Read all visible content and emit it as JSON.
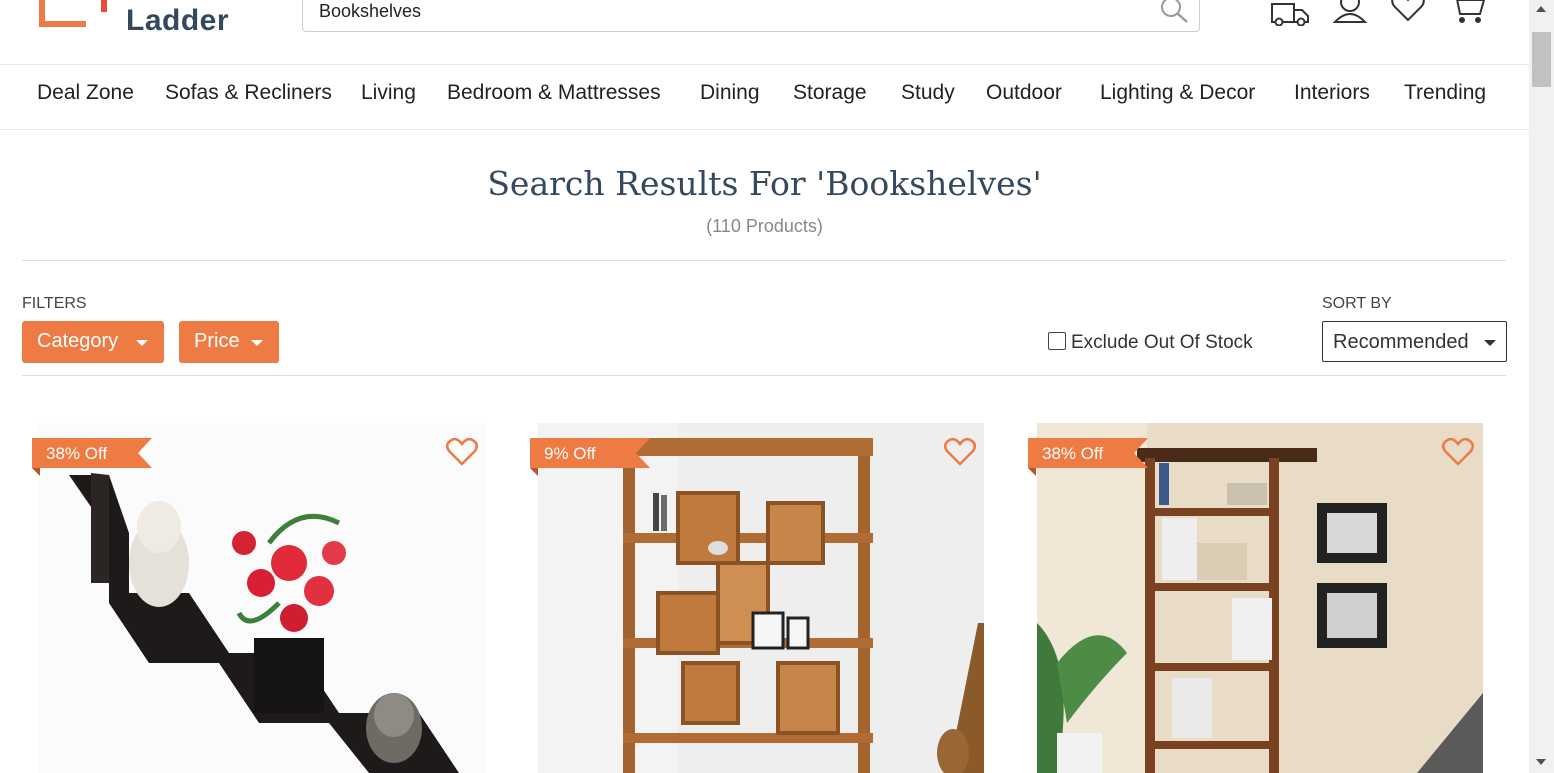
{
  "header": {
    "logo_text": "Ladder",
    "search_value": "Bookshelves",
    "icons": [
      "truck-icon",
      "user-icon",
      "heart-icon",
      "cart-icon"
    ]
  },
  "nav": {
    "items": [
      "Deal Zone",
      "Sofas & Recliners",
      "Living",
      "Bedroom & Mattresses",
      "Dining",
      "Storage",
      "Study",
      "Outdoor",
      "Lighting & Decor",
      "Interiors",
      "Trending"
    ]
  },
  "results": {
    "title": "Search Results For 'Bookshelves'",
    "count": "(110 Products)"
  },
  "filters": {
    "label": "FILTERS",
    "category_label": "Category",
    "price_label": "Price",
    "exclude_label": "Exclude Out Of Stock",
    "exclude_checked": false,
    "sort_label": "SORT BY",
    "sort_value": "Recommended"
  },
  "products": [
    {
      "badge": "38% Off"
    },
    {
      "badge": "9% Off"
    },
    {
      "badge": "38% Off"
    }
  ],
  "colors": {
    "accent": "#ee7a44",
    "heading": "#34495e"
  }
}
